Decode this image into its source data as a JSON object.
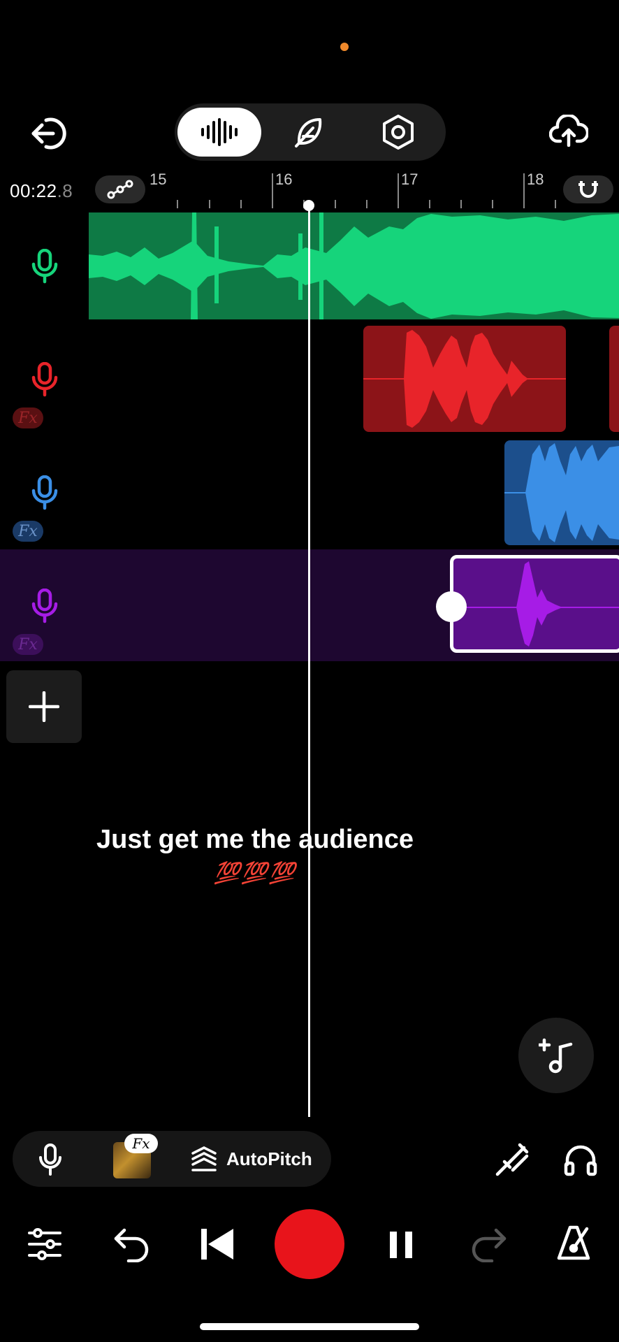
{
  "status": {
    "indicator_color": "#f0892b"
  },
  "header": {
    "exit_icon": "exit-icon",
    "upload_icon": "cloud-upload-icon",
    "modes": [
      {
        "name": "waveform",
        "icon": "waveform-icon",
        "active": true
      },
      {
        "name": "feather",
        "icon": "feather-icon",
        "active": false
      },
      {
        "name": "settings",
        "icon": "hex-nut-icon",
        "active": false
      }
    ]
  },
  "timeline": {
    "time_main": "00:22",
    "time_frac": ".8",
    "ruler_labels": [
      "15",
      "16",
      "17",
      "18"
    ],
    "playhead_color": "#ffffff"
  },
  "tracks": [
    {
      "name": "track-1",
      "color": "#16d47b",
      "mic_icon": "microphone-icon",
      "has_fx": false
    },
    {
      "name": "track-2",
      "color": "#e8242a",
      "mic_icon": "microphone-icon",
      "has_fx": true,
      "fx_label": "Fx"
    },
    {
      "name": "track-3",
      "color": "#3b8fe6",
      "mic_icon": "microphone-icon",
      "has_fx": true,
      "fx_label": "Fx"
    },
    {
      "name": "track-4",
      "color": "#a61ce6",
      "mic_icon": "microphone-icon",
      "has_fx": true,
      "fx_label": "Fx",
      "selected": true
    }
  ],
  "add_track_icon": "plus-icon",
  "overlay_caption": {
    "line1": "Just get me the audience",
    "line2": "💯💯💯"
  },
  "add_music_icon": "add-music-icon",
  "bottom_pill": {
    "mic_icon": "microphone-icon",
    "fx_label": "Fx",
    "autopitch_label": "AutoPitch",
    "autopitch_icon": "autopitch-icon"
  },
  "right_tools": {
    "tuning_fork_icon": "tuning-fork-icon",
    "headphones_icon": "headphones-icon"
  },
  "transport": {
    "mixer_icon": "sliders-icon",
    "undo_icon": "undo-icon",
    "skip_back_icon": "skip-back-icon",
    "record_color": "#e8141b",
    "pause_icon": "pause-icon",
    "redo_icon": "redo-icon",
    "metronome_icon": "metronome-icon"
  }
}
